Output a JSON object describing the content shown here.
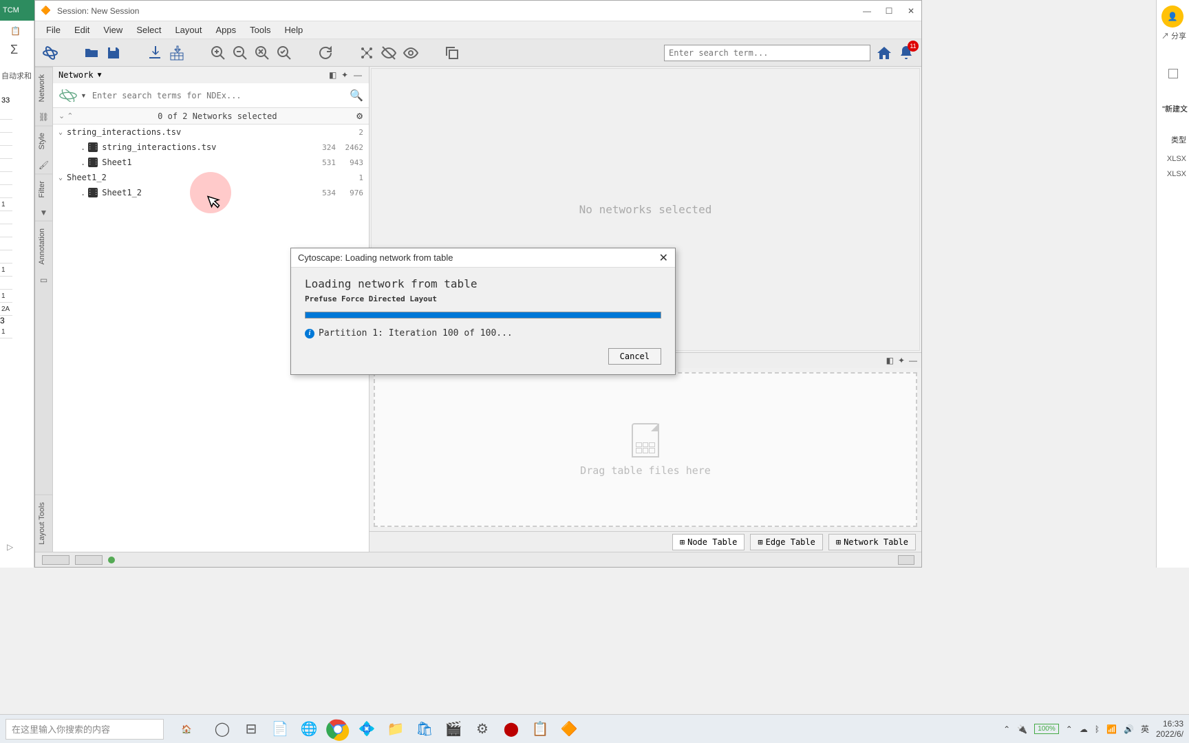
{
  "bg_left": {
    "tab": "TCM",
    "sum": "Σ",
    "autosum": "自动求和",
    "cell_ref": "33",
    "cells": [
      "",
      "",
      "",
      "",
      "",
      "",
      "",
      "1",
      "",
      "",
      "",
      "",
      "1",
      "",
      "1",
      "2A",
      "3",
      "1",
      "",
      "",
      ""
    ]
  },
  "bg_right": {
    "share": "分享",
    "new_text": "\"新建文",
    "type": "类型",
    "xlsx1": "XLSX",
    "xlsx2": "XLSX"
  },
  "titlebar": {
    "text": "Session: New Session"
  },
  "menu": [
    "File",
    "Edit",
    "View",
    "Select",
    "Layout",
    "Apps",
    "Tools",
    "Help"
  ],
  "toolbar": {
    "search_placeholder": "Enter search term...",
    "notif_count": "11"
  },
  "network_panel": {
    "header": "Network",
    "search_placeholder": "Enter search terms for NDEx...",
    "status": "0 of 2 Networks selected",
    "tree": [
      {
        "type": "collection",
        "label": "string_interactions.tsv",
        "count": "2"
      },
      {
        "type": "network",
        "label": "string_interactions.tsv",
        "n1": "324",
        "n2": "2462"
      },
      {
        "type": "network",
        "label": "Sheet1",
        "n1": "531",
        "n2": "943"
      },
      {
        "type": "collection",
        "label": "Sheet1_2",
        "count": "1"
      },
      {
        "type": "network",
        "label": "Sheet1_2",
        "n1": "534",
        "n2": "976"
      }
    ]
  },
  "canvas": {
    "empty_text": "No networks selected",
    "drop_text": "Drag table files here",
    "tabs": [
      "Node Table",
      "Edge Table",
      "Network Table"
    ]
  },
  "side_tabs": [
    "Network",
    "Style",
    "Filter",
    "Annotation"
  ],
  "layout_tools": "Layout Tools",
  "dialog": {
    "title": "Cytoscape: Loading network from table",
    "heading": "Loading network from table",
    "subheading": "Prefuse Force Directed Layout",
    "info": "Partition 1: Iteration 100 of 100...",
    "cancel": "Cancel"
  },
  "taskbar": {
    "search": "在这里输入你搜索的内容",
    "battery": "100%",
    "ime": "英",
    "time": "16:33",
    "date": "2022/6/"
  }
}
